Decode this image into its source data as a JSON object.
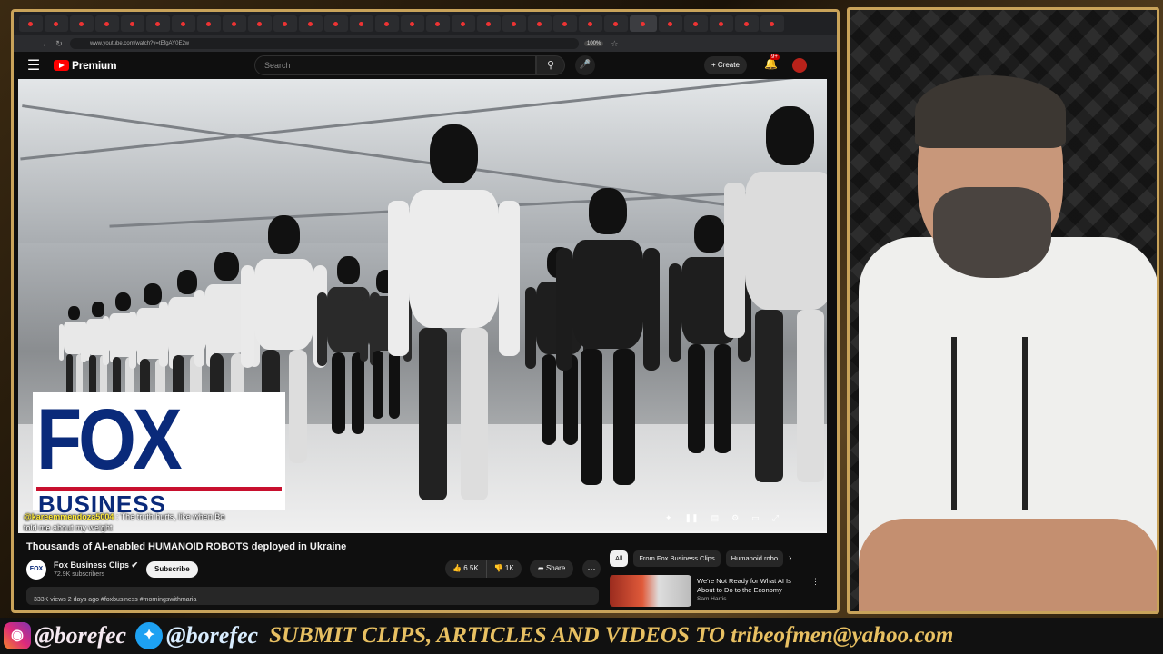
{
  "browser": {
    "url": "www.youtube.com/watch?v=tEfgAY0E2w",
    "zoom": "100%",
    "tabs_count": 30
  },
  "youtube": {
    "logo_label": "Premium",
    "search_placeholder": "Search",
    "create_label": "Create",
    "notifications_badge": "9+"
  },
  "video": {
    "logo_main": "FOX",
    "logo_sub": "BUSINESS",
    "chat": {
      "user": "@kareemmendoza5004",
      "message": "The truth hurts, like when Bo",
      "message_line2": "told me about my weight"
    },
    "title": "Thousands of AI-enabled HUMANOID ROBOTS deployed in Ukraine",
    "channel_name": "Fox Business Clips",
    "channel_avatar": "FOX",
    "subscribers": "72.9K subscribers",
    "subscribe_label": "Subscribe",
    "likes": "6.5K",
    "dislikes": "1K",
    "share_label": "Share",
    "description": "333K views  2 days ago  #foxbusiness #morningswithmaria"
  },
  "sidebar": {
    "chips": [
      "All",
      "From Fox Business Clips",
      "Humanoid robo"
    ],
    "recommendation": {
      "title": "We're Not Ready for What AI Is About to Do to the Economy",
      "channel": "Sam Harris"
    }
  },
  "banner": {
    "instagram_handle": "@borefec",
    "twitter_handle": "@borefec",
    "submit_text": "SUBMIT CLIPS, ARTICLES AND VIDEOS TO tribeofmen@yahoo.com"
  },
  "colors": {
    "frame_gold": "#c9a35a",
    "youtube_red": "#ff0000",
    "fox_blue": "#0a2a7a",
    "banner_text": "#e8c062"
  }
}
